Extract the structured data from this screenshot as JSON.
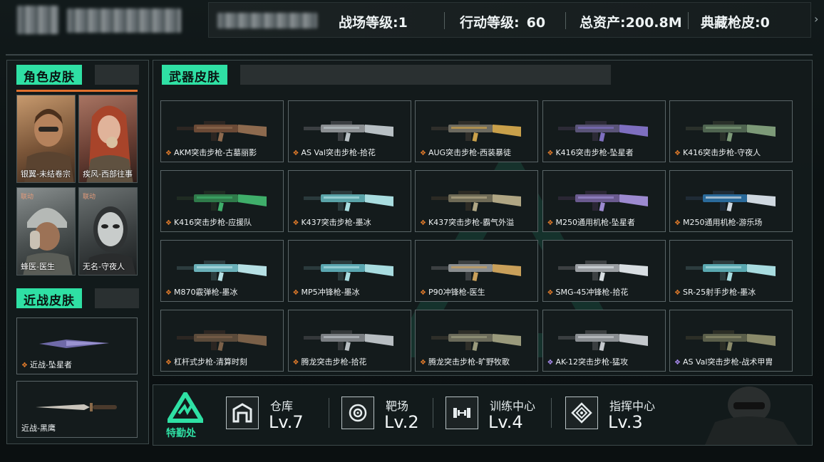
{
  "header": {
    "stats": [
      {
        "label": "战场等级",
        "value": "1"
      },
      {
        "label": "行动等级",
        "value": "60"
      },
      {
        "label": "总资产",
        "value": "200.8M"
      },
      {
        "label": "典藏枪皮",
        "value": "0"
      }
    ]
  },
  "character_skins": {
    "title": "角色皮肤",
    "items": [
      {
        "label": "银翼-未结卷宗",
        "tag": ""
      },
      {
        "label": "疾风-西部往事",
        "tag": ""
      },
      {
        "label": "蜂医-医生",
        "tag": "联动"
      },
      {
        "label": "无名-守夜人",
        "tag": "联动"
      }
    ]
  },
  "melee_skins": {
    "title": "近战皮肤",
    "items": [
      {
        "label": "近战-坠星者",
        "rarity": "orange"
      },
      {
        "label": "近战-黑鹰",
        "rarity": "none"
      }
    ]
  },
  "weapon_skins": {
    "title": "武器皮肤",
    "items": [
      {
        "label": "AKM突击步枪-古墓丽影",
        "rarity": "orange"
      },
      {
        "label": "AS Val突击步枪-拾花",
        "rarity": "orange"
      },
      {
        "label": "AUG突击步枪-西装暴徒",
        "rarity": "orange"
      },
      {
        "label": "K416突击步枪-坠星者",
        "rarity": "orange"
      },
      {
        "label": "K416突击步枪-守夜人",
        "rarity": "orange"
      },
      {
        "label": "K416突击步枪-应援队",
        "rarity": "orange"
      },
      {
        "label": "K437突击步枪-墨冰",
        "rarity": "orange"
      },
      {
        "label": "K437突击步枪-霸气外溢",
        "rarity": "orange"
      },
      {
        "label": "M250通用机枪-坠星者",
        "rarity": "orange"
      },
      {
        "label": "M250通用机枪-游乐场",
        "rarity": "orange"
      },
      {
        "label": "M870霰弹枪-墨冰",
        "rarity": "orange"
      },
      {
        "label": "MP5冲锋枪-墨冰",
        "rarity": "orange"
      },
      {
        "label": "P90冲锋枪-医生",
        "rarity": "orange"
      },
      {
        "label": "SMG-45冲锋枪-拾花",
        "rarity": "orange"
      },
      {
        "label": "SR-25射手步枪-墨冰",
        "rarity": "orange"
      },
      {
        "label": "杠杆式步枪-清算时刻",
        "rarity": "orange"
      },
      {
        "label": "腾龙突击步枪-拾花",
        "rarity": "orange"
      },
      {
        "label": "腾龙突击步枪-旷野牧歌",
        "rarity": "orange"
      },
      {
        "label": "AK-12突击步枪-猛攻",
        "rarity": "purple"
      },
      {
        "label": "AS Val突击步枪-战术甲胄",
        "rarity": "purple"
      }
    ]
  },
  "bottom": {
    "logo_label": "特勤处",
    "facilities": [
      {
        "name": "仓库",
        "level": "Lv.7",
        "icon": "warehouse-icon"
      },
      {
        "name": "靶场",
        "level": "Lv.2",
        "icon": "target-icon"
      },
      {
        "name": "训练中心",
        "level": "Lv.4",
        "icon": "dumbbell-icon"
      },
      {
        "name": "指挥中心",
        "level": "Lv.3",
        "icon": "command-icon"
      }
    ]
  },
  "colors": {
    "accent": "#2fe0a4",
    "orange": "#e0702d",
    "purple": "#8b6ae0"
  }
}
